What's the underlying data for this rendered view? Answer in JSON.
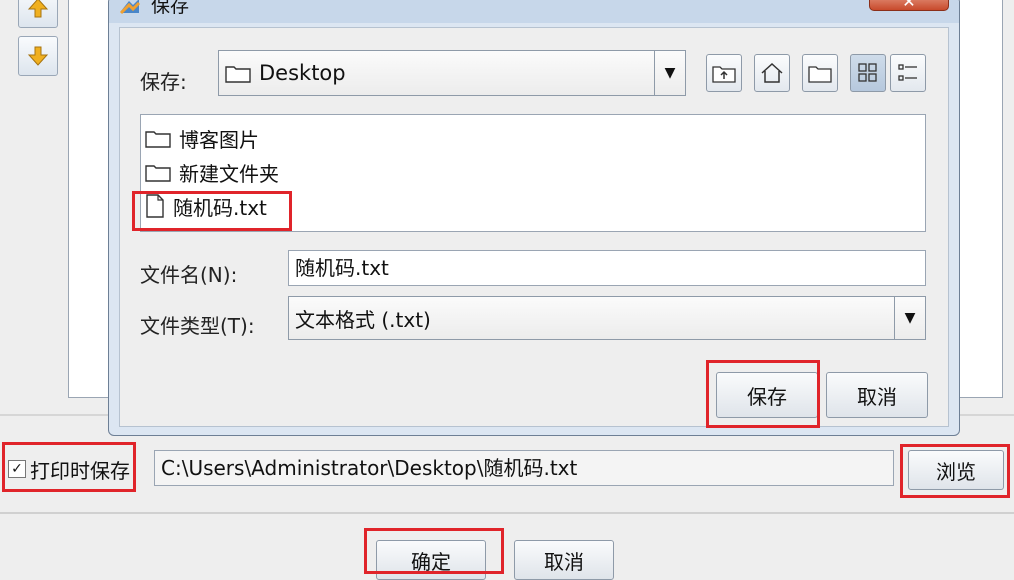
{
  "dialog": {
    "title": "保存",
    "close_glyph": "✕",
    "save_in_label": "保存:",
    "save_in_value": "Desktop",
    "toolbar_icons": [
      "up-folder-icon",
      "home-icon",
      "new-folder-icon",
      "list-view-icon",
      "details-view-icon"
    ],
    "files": [
      {
        "name": "博客图片",
        "type": "folder"
      },
      {
        "name": "新建文件夹",
        "type": "folder"
      },
      {
        "name": "随机码.txt",
        "type": "file"
      }
    ],
    "filename_label": "文件名(N):",
    "filename_value": "随机码.txt",
    "filetype_label": "文件类型(T):",
    "filetype_value": "文本格式 (.txt)",
    "save_button": "保存",
    "cancel_button": "取消"
  },
  "main": {
    "print_save_label": "打印时保存",
    "print_save_checked": true,
    "check_glyph": "✓",
    "path_value": "C:\\Users\\Administrator\\Desktop\\随机码.txt",
    "browse_button": "浏览",
    "ok_button": "确定",
    "cancel_button": "取消"
  },
  "colors": {
    "highlight_red": "#e0242a",
    "dialog_frame": "#dce6f2",
    "close_button": "#c84a2c"
  }
}
